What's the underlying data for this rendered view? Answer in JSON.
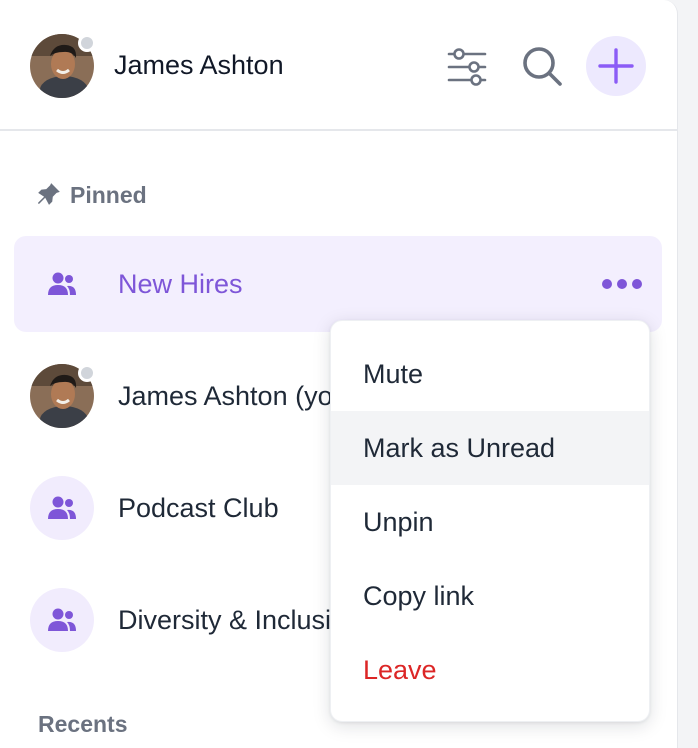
{
  "user": {
    "name": "James Ashton",
    "presence": "offline"
  },
  "header_actions": {
    "filter_icon": "sliders-icon",
    "search_icon": "search-icon",
    "add_icon": "plus-icon"
  },
  "sections": {
    "pinned": "Pinned",
    "recents": "Recents"
  },
  "channels": [
    {
      "label": "New Hires",
      "icon": "users-icon",
      "active": true
    },
    {
      "label": "James Ashton (you)",
      "icon": "avatar",
      "active": false
    },
    {
      "label": "Podcast Club",
      "icon": "users-icon",
      "active": false
    },
    {
      "label": "Diversity & Inclusion",
      "icon": "users-icon",
      "active": false
    }
  ],
  "context_menu": {
    "items": [
      {
        "label": "Mute"
      },
      {
        "label": "Mark as Unread",
        "hovered": true
      },
      {
        "label": "Unpin"
      },
      {
        "label": "Copy link"
      },
      {
        "label": "Leave",
        "danger": true
      }
    ]
  },
  "colors": {
    "accent": "#7e56d8",
    "accent_light": "#f3effe",
    "danger": "#dc2626",
    "muted_text": "#6b7280"
  }
}
